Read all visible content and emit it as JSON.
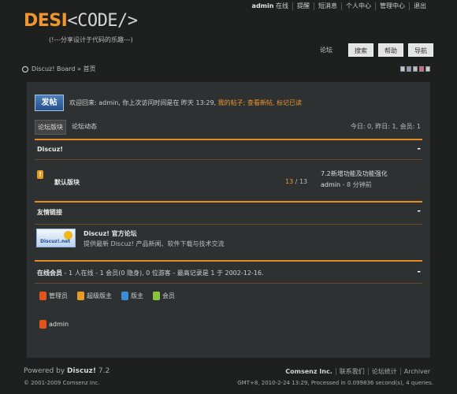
{
  "userbar": {
    "username": "admin",
    "status": "在线",
    "links": [
      "提醒",
      "短消息",
      "个人中心",
      "管理中心",
      "退出"
    ]
  },
  "logo": {
    "part1": "DESI",
    "part2": "<CODE/>"
  },
  "tagline": "(!---分享设计于代码的乐趣---)",
  "nav": {
    "label": "论坛",
    "buttons": [
      "搜索",
      "帮助",
      "导航"
    ]
  },
  "breadcrumb": "Discuz! Board » 首页",
  "swatch_colors": [
    "#b8c8e0",
    "#8aa0c0",
    "#c0c0c0",
    "#e06090",
    "#cccccc"
  ],
  "post_button": "发帖",
  "welcome": {
    "text": "欢迎回来: admin, 你上次访问时间是在 昨天 13:29,",
    "link1": "我的帖子;",
    "link2": "查看新帖,",
    "link3": "标记已读"
  },
  "tabs": [
    "论坛版块",
    "论坛动态"
  ],
  "stats": "今日: 0, 昨日: 1, 会员: 1",
  "category": {
    "title": "Discuz!",
    "toggle": "-"
  },
  "forum": {
    "icon_label": "!",
    "name": "默认版块",
    "count_threads": "13",
    "count_sep": " / ",
    "count_posts": "13",
    "last_title": "7.2新增功能及功能强化",
    "last_user": "admin",
    "last_time": "- 8 分钟前"
  },
  "links_section": {
    "title": "友情链接",
    "toggle": "-"
  },
  "friend_link": {
    "logo_text": "Discuz!.net",
    "title": "Discuz! 官方论坛",
    "desc": "提供最新 Discuz! 产品新闻、软件下载与技术交流"
  },
  "online": {
    "label": "在线会员",
    "detail": "- 1 人在线 - 1 会员(0 隐身), 0 位游客 - 最高记录是 1 于 2002-12-16.",
    "toggle": "-"
  },
  "legend": [
    {
      "label": "管理员",
      "color": "#e2541a"
    },
    {
      "label": "超级版主",
      "color": "#e89b22"
    },
    {
      "label": "版主",
      "color": "#3a8ed8"
    },
    {
      "label": "会员",
      "color": "#8bc43a"
    }
  ],
  "online_member": "admin",
  "footer": {
    "powered_prefix": "Powered by ",
    "powered_name": "Discuz!",
    "powered_version": " 7.2",
    "copyright": "© 2001-2009 Comsenz Inc.",
    "links": [
      "Comsenz Inc.",
      "联系我们",
      "论坛统计",
      "Archiver"
    ],
    "processed": "GMT+8, 2010-2-24 13:29, Processed in 0.099836 second(s), 4 queries."
  }
}
